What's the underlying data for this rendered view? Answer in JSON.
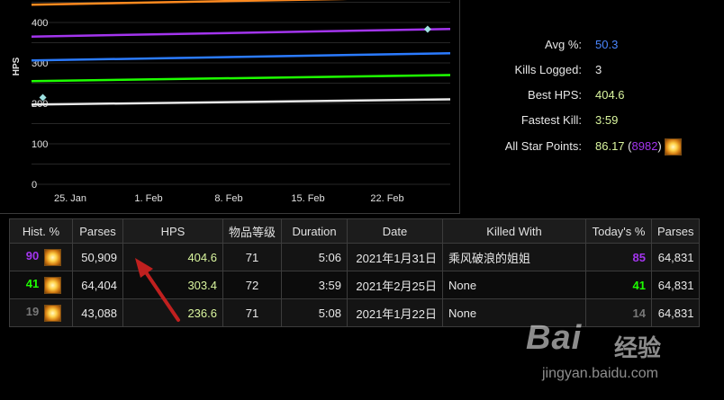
{
  "chart": {
    "ylabel": "HPS",
    "yticks": [
      {
        "value": 0,
        "label": "0"
      },
      {
        "value": 100,
        "label": "100"
      },
      {
        "value": 200,
        "label": "200"
      },
      {
        "value": 300,
        "label": "300"
      },
      {
        "value": 400,
        "label": "400"
      }
    ],
    "xticks": [
      "25. Jan",
      "1. Feb",
      "8. Feb",
      "15. Feb",
      "22. Feb"
    ]
  },
  "chart_data": {
    "type": "line",
    "ylabel": "HPS",
    "ylim": [
      0,
      470
    ],
    "xlim": [
      "2021-01-21",
      "2021-02-27"
    ],
    "grid": true,
    "series": [
      {
        "color": "#ff8a1f",
        "x": [
          "2021-01-21",
          "2021-02-27"
        ],
        "y": [
          444,
          463
        ]
      },
      {
        "color": "#a335ee",
        "x": [
          "2021-01-21",
          "2021-02-27"
        ],
        "y": [
          365,
          384
        ]
      },
      {
        "color": "#2b7bff",
        "x": [
          "2021-01-21",
          "2021-02-27"
        ],
        "y": [
          306,
          324
        ]
      },
      {
        "color": "#1eff00",
        "x": [
          "2021-01-21",
          "2021-02-27"
        ],
        "y": [
          255,
          270
        ]
      },
      {
        "color": "#e8e8e8",
        "x": [
          "2021-01-21",
          "2021-02-27"
        ],
        "y": [
          197,
          210
        ]
      },
      {
        "color": "#9de0e0",
        "type": "scatter",
        "x": [
          "2021-01-22",
          "2021-01-31",
          "2021-02-25"
        ],
        "y": [
          236.6,
          404.6,
          303.4
        ]
      }
    ]
  },
  "stats": [
    {
      "label": "Avg %:",
      "value": "50.3",
      "color": "#4a86ff"
    },
    {
      "label": "Kills Logged:",
      "value": "3",
      "color": "#e6e6e6"
    },
    {
      "label": "Best HPS:",
      "value": "404.6",
      "color": "#d9f59e"
    },
    {
      "label": "Fastest Kill:",
      "value": "3:59",
      "color": "#d9f59e"
    },
    {
      "label": "All Star Points:",
      "value": "86.17",
      "extra_open": " (",
      "extra": "8982",
      "extra_close": ")",
      "color": "#d9f59e",
      "extra_color": "#a335ee"
    }
  ],
  "table": {
    "headers": [
      "Hist. %",
      "Parses",
      "HPS",
      "物品等级",
      "Duration",
      "Date",
      "Killed With",
      "Today's %",
      "Parses"
    ],
    "rows": [
      {
        "hist": "90",
        "hist_color": "#a335ee",
        "parses": "50,909",
        "hps": "404.6",
        "ilvl": "71",
        "duration": "5:06",
        "date": "2021年1月31日",
        "killed_with": "乘风破浪的姐姐",
        "killed_link": true,
        "today": "85",
        "today_color": "#a335ee",
        "parses2": "64,831"
      },
      {
        "hist": "41",
        "hist_color": "#1eff00",
        "parses": "64,404",
        "hps": "303.4",
        "ilvl": "72",
        "duration": "3:59",
        "date": "2021年2月25日",
        "killed_with": "None",
        "killed_link": false,
        "today": "41",
        "today_color": "#1eff00",
        "parses2": "64,831"
      },
      {
        "hist": "19",
        "hist_color": "#777777",
        "parses": "43,088",
        "hps": "236.6",
        "ilvl": "71",
        "duration": "5:08",
        "date": "2021年1月22日",
        "killed_with": "None",
        "killed_link": false,
        "today": "14",
        "today_color": "#777777",
        "parses2": "64,831"
      }
    ]
  },
  "annotation": {
    "arrow_color": "#c0201f"
  },
  "watermark": {
    "logo": "Bai",
    "brand": "经验",
    "url": "jingyan.baidu.com"
  }
}
